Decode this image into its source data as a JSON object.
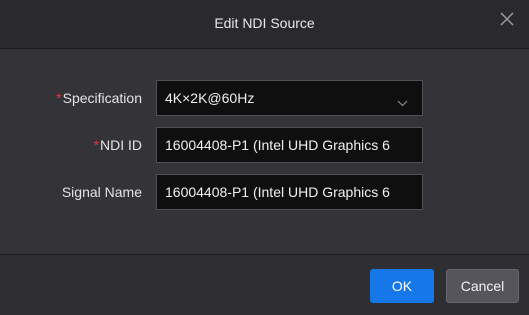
{
  "dialog": {
    "title": "Edit NDI Source",
    "close_icon": "close-icon"
  },
  "form": {
    "specification": {
      "required_mark": "*",
      "label": "Specification",
      "value": "4K×2K@60Hz",
      "icon": "chevron-down-icon"
    },
    "ndi_id": {
      "required_mark": "*",
      "label": "NDI ID",
      "value": "16004408-P1 (Intel UHD Graphics 6"
    },
    "signal_name": {
      "label": "Signal Name",
      "value": "16004408-P1 (Intel UHD Graphics 6"
    }
  },
  "footer": {
    "ok_label": "OK",
    "cancel_label": "Cancel"
  },
  "colors": {
    "accent": "#1677e8",
    "required": "#e0393e",
    "background": "#333338"
  }
}
